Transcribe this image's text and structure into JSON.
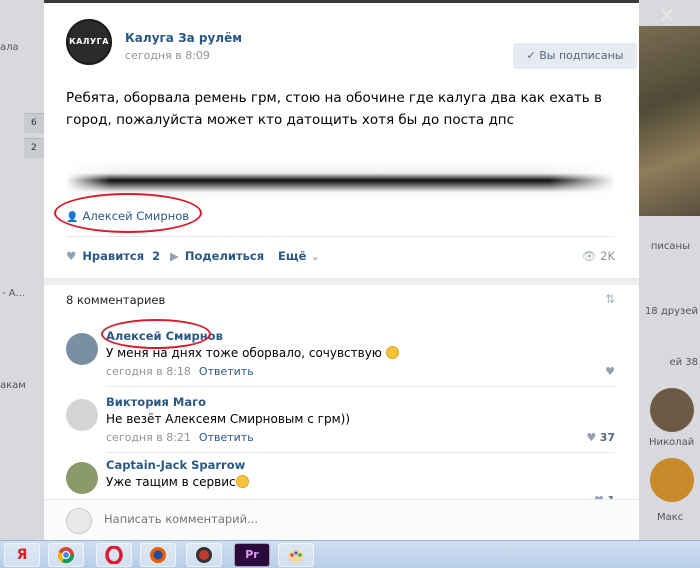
{
  "background": {
    "left_texts": [
      "ала",
      "6",
      "2",
      "- А...",
      "акам"
    ],
    "right_texts": [
      "писаны",
      "18 друзей",
      "ей 38",
      "Николай",
      "Макс"
    ]
  },
  "nav": {
    "prev_icon": "chevron-left-icon",
    "next_icon": "chevron-right-icon",
    "close_icon": "close-icon"
  },
  "post": {
    "group_name": "Калуга За рулём",
    "group_avatar_text": "КАЛУГА",
    "time": "сегодня в 8:09",
    "subscribed_label": "✓  Вы подписаны",
    "text": "Ребята, оборвала ремень грм, стою на обочине где калуга два как ехать в город, пожалуйста может кто датощить хотя бы до поста дпс",
    "signer": "Алексей Смирнов",
    "actions": {
      "like_label": "Нравится",
      "like_count": "2",
      "share_label": "Поделиться",
      "more_label": "Ещё",
      "views": "2K"
    }
  },
  "comments_header": "8 комментариев",
  "comments": [
    {
      "name": "Алексей Смирнов",
      "text": "У меня на днях тоже оборвало, сочувствую",
      "time": "сегодня в 8:18",
      "reply": "Ответить",
      "likes": ""
    },
    {
      "name": "Виктория Маго",
      "text": "Не везёт Алексеям Смирновым с грм))",
      "time": "сегодня в 8:21",
      "reply": "Ответить",
      "likes": "37"
    },
    {
      "name": "Captain-Jack Sparrow",
      "text": "Уже тащим в сервис",
      "time": "",
      "reply": "",
      "likes": "1"
    }
  ],
  "compose": {
    "placeholder": "Написать комментарий..."
  },
  "taskbar": {
    "items": [
      "Я",
      "chrome",
      "opera",
      "firefox",
      "media",
      "Pr",
      "paint"
    ]
  },
  "colors": {
    "link": "#2a5885",
    "annotation_red": "#d21e2b",
    "accent_bg": "#e5ebf1"
  }
}
